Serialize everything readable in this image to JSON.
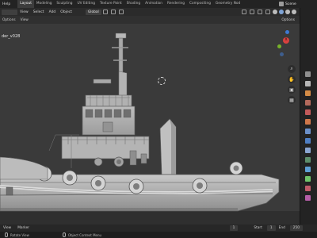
{
  "topbar": {
    "menus": [
      "Help"
    ],
    "workspaces": [
      "Layout",
      "Modeling",
      "Sculpting",
      "UV Editing",
      "Texture Paint",
      "Shading",
      "Animation",
      "Rendering",
      "Compositing",
      "Geometry Nod"
    ],
    "active_workspace": "Layout",
    "scene_label": "Scene"
  },
  "viewport_header": {
    "menus": [
      "View",
      "Select",
      "Add",
      "Object"
    ],
    "orientation": "Global"
  },
  "sub_header": {
    "items": [
      "Options",
      "View"
    ],
    "options_label": "Options"
  },
  "viewport": {
    "object_name": "der_v028"
  },
  "timeline": {
    "items": [
      "View",
      "Marker"
    ],
    "current_frame": "1",
    "start_label": "Start",
    "start_value": "1",
    "end_label": "End",
    "end_value": "250"
  },
  "statusbar": {
    "rotate_view": "Rotate View",
    "context_menu": "Object Context Menu"
  },
  "colors": {
    "accent": "#4772b3",
    "axis_x": "#d8413f",
    "axis_y": "#77b22a",
    "axis_z": "#3e79d3"
  }
}
